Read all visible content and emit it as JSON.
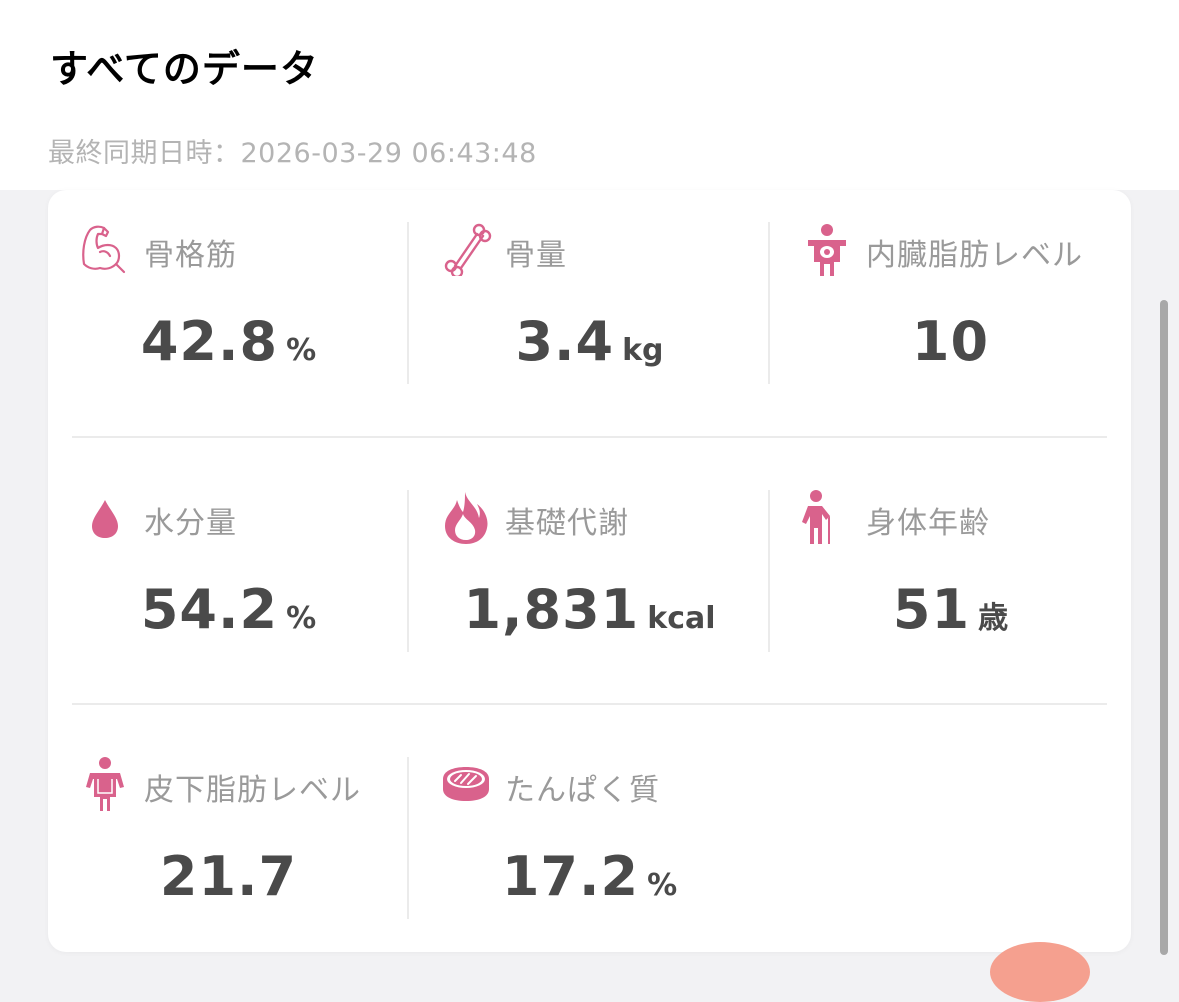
{
  "header": {
    "title": "すべてのデータ",
    "sync_label": "最終同期日時：",
    "sync_value": "2026-03-29 06:43:48"
  },
  "accent_color": "#d9628c",
  "metrics": [
    {
      "label": "骨格筋",
      "value": "42.8",
      "unit": "%",
      "icon": "muscle-icon"
    },
    {
      "label": "骨量",
      "value": "3.4",
      "unit": "kg",
      "icon": "bone-icon"
    },
    {
      "label": "内臓脂肪レベル",
      "value": "10",
      "unit": "",
      "icon": "visceral-fat-icon"
    },
    {
      "label": "水分量",
      "value": "54.2",
      "unit": "%",
      "icon": "water-drop-icon"
    },
    {
      "label": "基礎代謝",
      "value": "1,831",
      "unit": "kcal",
      "icon": "flame-icon"
    },
    {
      "label": "身体年齢",
      "value": "51",
      "unit": "歳",
      "icon": "elderly-person-icon"
    },
    {
      "label": "皮下脂肪レベル",
      "value": "21.7",
      "unit": "",
      "icon": "subcutaneous-fat-icon"
    },
    {
      "label": "たんぱく質",
      "value": "17.2",
      "unit": "%",
      "icon": "meat-icon"
    }
  ]
}
